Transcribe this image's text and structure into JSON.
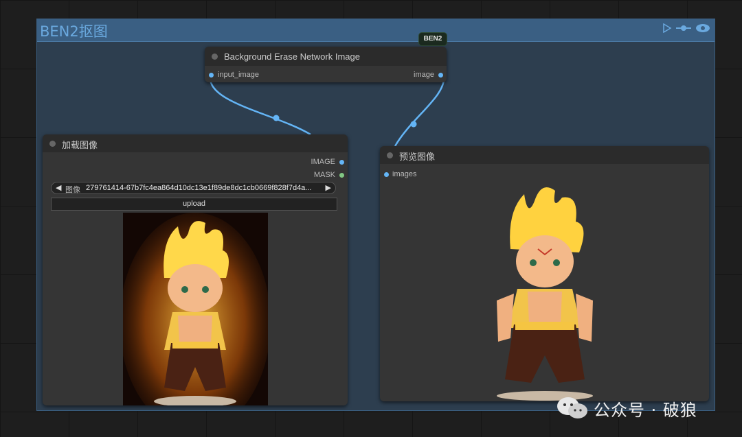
{
  "group": {
    "title": "BEN2抠图"
  },
  "ben_node": {
    "badge": "BEN2",
    "title": "Background Erase Network Image",
    "input_label": "input_image",
    "output_label": "image"
  },
  "load_node": {
    "title": "加载图像",
    "output_image_label": "IMAGE",
    "output_mask_label": "MASK",
    "combo_label": "图像",
    "combo_value": "279761414-67b7fc4ea864d10dc13e1f89de8dc1cb0669f828f7d4a...",
    "upload_label": "upload"
  },
  "preview_node": {
    "title": "预览图像",
    "input_label": "images"
  },
  "watermark": {
    "text": "公众号 · 破狼"
  },
  "colors": {
    "accent_blue": "#64b5f6",
    "mask_green": "#81c784",
    "group_header": "#3a5f83",
    "link": "#64b5f6"
  }
}
